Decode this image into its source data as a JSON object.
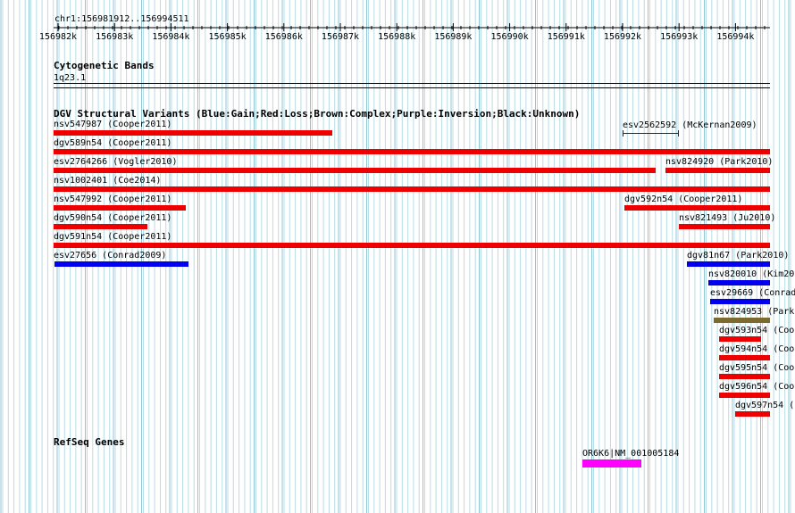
{
  "ruler": {
    "location": "chr1:156981912..156994511",
    "ticks": [
      "156982k",
      "156983k",
      "156984k",
      "156985k",
      "156986k",
      "156987k",
      "156988k",
      "156989k",
      "156990k",
      "156991k",
      "156992k",
      "156993k",
      "156994k"
    ]
  },
  "cytoband": {
    "title": "Cytogenetic Bands",
    "band": "1q23.1"
  },
  "dgv": {
    "title": "DGV Structural Variants (Blue:Gain;Red:Loss;Brown:Complex;Purple:Inversion;Black:Unknown)",
    "colors": {
      "gain": "#0000ee",
      "loss": "#ee0000",
      "complex": "#7b6b2f",
      "marker": "#1a1a9a"
    },
    "features": [
      {
        "label": "nsv547987 (Cooper2011)",
        "type": "loss"
      },
      {
        "label": "esv2562592 (McKernan2009)",
        "type": "marker"
      },
      {
        "label": "dgv589n54 (Cooper2011)",
        "type": "loss"
      },
      {
        "label": "esv2764266 (Vogler2010)",
        "type": "loss"
      },
      {
        "label": "nsv824920 (Park2010)",
        "type": "loss"
      },
      {
        "label": "nsv1002401 (Coe2014)",
        "type": "loss"
      },
      {
        "label": "nsv547992 (Cooper2011)",
        "type": "loss"
      },
      {
        "label": "dgv592n54 (Cooper2011)",
        "type": "loss"
      },
      {
        "label": "dgv590n54 (Cooper2011)",
        "type": "loss"
      },
      {
        "label": "nsv821493 (Ju2010)",
        "type": "loss"
      },
      {
        "label": "dgv591n54 (Cooper2011)",
        "type": "loss"
      },
      {
        "label": "esv27656 (Conrad2009)",
        "type": "gain"
      },
      {
        "label": "dgv81n67 (Park2010)",
        "type": "gain"
      },
      {
        "label": "nsv820010 (Kim20",
        "type": "gain"
      },
      {
        "label": "esv29669 (Conrad",
        "type": "gain"
      },
      {
        "label": "nsv824953 (Park2",
        "type": "complex"
      },
      {
        "label": "dgv593n54 (Coop",
        "type": "loss"
      },
      {
        "label": "dgv594n54 (Coop",
        "type": "loss"
      },
      {
        "label": "dgv595n54 (Coop",
        "type": "loss"
      },
      {
        "label": "dgv596n54 (Coop",
        "type": "loss"
      },
      {
        "label": "dgv597n54 (",
        "type": "loss"
      }
    ]
  },
  "refseq": {
    "title": "RefSeq Genes",
    "genes": [
      {
        "label": "OR6K6|NM_001005184",
        "color": "#ff00ff"
      }
    ]
  }
}
